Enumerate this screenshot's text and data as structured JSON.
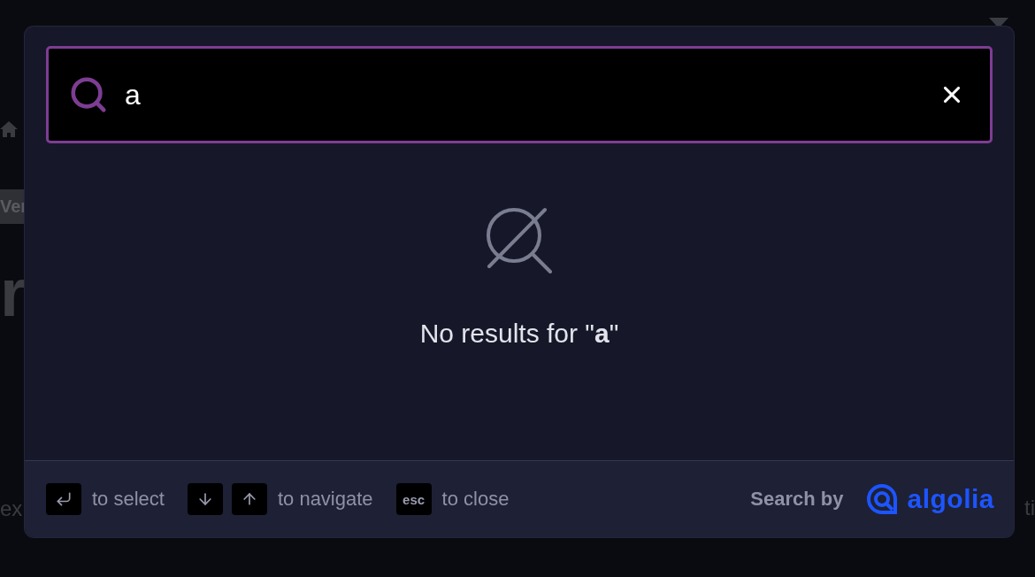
{
  "background": {
    "badge": "Ver",
    "heading_1": "r",
    "text_left": "ex",
    "text_right": "ti"
  },
  "search": {
    "query": "a"
  },
  "empty_state": {
    "message": "No results for \"**a**\""
  },
  "footer": {
    "hints": [
      {
        "keys": [
          {
            "kind": "enter"
          }
        ],
        "label": "to select"
      },
      {
        "keys": [
          {
            "kind": "down"
          },
          {
            "kind": "up"
          }
        ],
        "label": "to navigate"
      },
      {
        "keys": [
          {
            "kind": "text",
            "label": "esc"
          }
        ],
        "label": "to close"
      }
    ],
    "credit": "Search by",
    "logo": "algolia"
  }
}
